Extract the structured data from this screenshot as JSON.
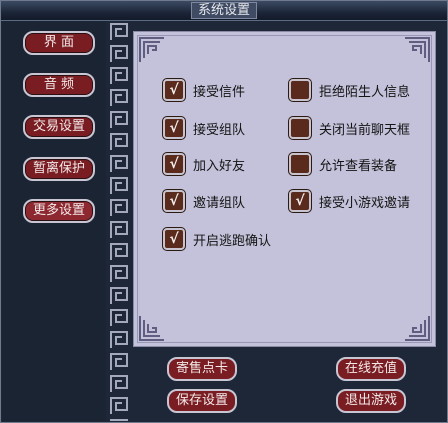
{
  "window": {
    "title": "系统设置"
  },
  "tabs": [
    {
      "label": "界 面",
      "active": false
    },
    {
      "label": "音 频",
      "active": false
    },
    {
      "label": "交易设置",
      "active": false
    },
    {
      "label": "暂离保护",
      "active": false
    },
    {
      "label": "更多设置",
      "active": true
    }
  ],
  "options_left": [
    {
      "label": "接受信件",
      "checked": true
    },
    {
      "label": "接受组队",
      "checked": true
    },
    {
      "label": "加入好友",
      "checked": true
    },
    {
      "label": "邀请组队",
      "checked": true
    },
    {
      "label": "开启逃跑确认",
      "checked": true
    }
  ],
  "options_right": [
    {
      "label": "拒绝陌生人信息",
      "checked": false
    },
    {
      "label": "关闭当前聊天框",
      "checked": false
    },
    {
      "label": "允许查看装备",
      "checked": false
    },
    {
      "label": "接受小游戏邀请",
      "checked": true
    }
  ],
  "checkmark": "√",
  "bottom_buttons": {
    "consign_card": "寄售点卡",
    "save_settings": "保存设置",
    "online_recharge": "在线充值",
    "exit_game": "退出游戏"
  },
  "colors": {
    "button_red": "#7a1d23",
    "panel_bg": "#c4c2da",
    "checkbox_bg": "#5a2a1d",
    "window_bg": "#1d2737"
  }
}
